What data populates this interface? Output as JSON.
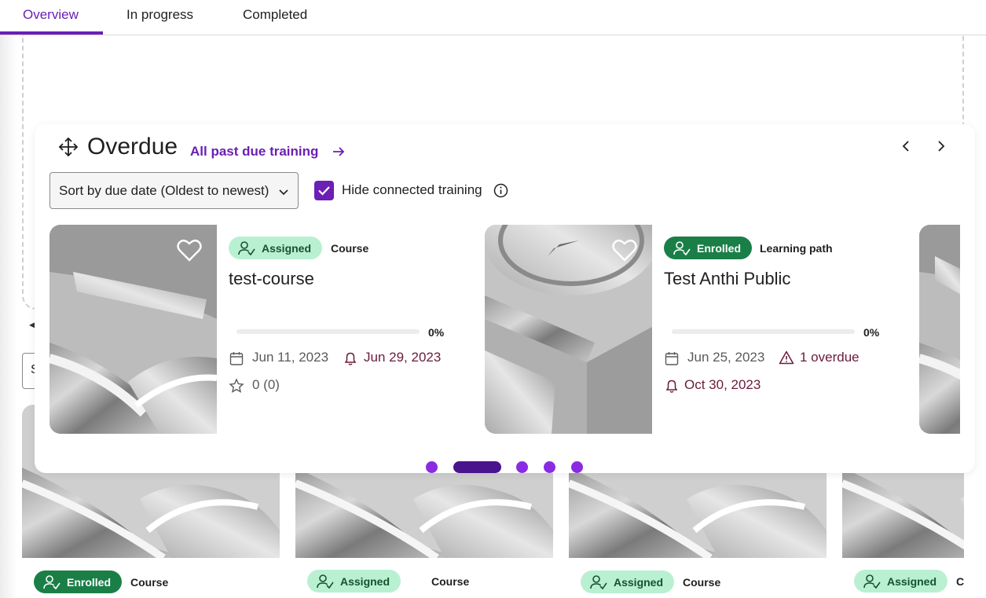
{
  "tabs": [
    {
      "label": "Overview",
      "active": true
    },
    {
      "label": "In progress",
      "active": false
    },
    {
      "label": "Completed",
      "active": false
    }
  ],
  "background": {
    "select_fragment": "S",
    "cards": [
      {
        "status": "Enrolled",
        "type": "Course"
      },
      {
        "status": "Assigned",
        "type": "Course"
      },
      {
        "status": "Assigned",
        "type": "Course"
      },
      {
        "status": "Assigned",
        "type": "C"
      }
    ]
  },
  "overdue": {
    "title": "Overdue",
    "link_label": "All past due training",
    "sort_label": "Sort by due date (Oldest to newest)",
    "hide_connected_label": "Hide connected training",
    "hide_connected_checked": true,
    "cards": [
      {
        "status": "Assigned",
        "type": "Course",
        "title": "test-course",
        "progress_label": "0%",
        "progress": 0,
        "start_date": "Jun 11, 2023",
        "due_date": "Jun 29, 2023",
        "rating": "0 (0)"
      },
      {
        "status": "Enrolled",
        "type": "Learning path",
        "title": "Test Anthi Public",
        "progress_label": "0%",
        "progress": 0,
        "start_date": "Jun 25, 2023",
        "overdue_label": "1 overdue",
        "due_date": "Oct 30, 2023"
      }
    ],
    "pagination": {
      "total": 5,
      "active_index": 1
    }
  },
  "colors": {
    "accent": "#6b1fb5",
    "enrolled_badge": "#1a7f47",
    "assigned_badge": "#b9f0d2",
    "due_text": "#6b1b3c",
    "dot": "#8a2be2",
    "dot_active": "#4a148c"
  }
}
